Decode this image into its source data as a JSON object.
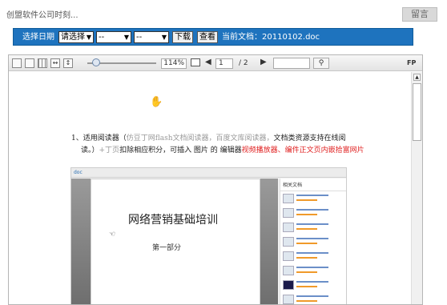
{
  "header": {
    "site_title": "创盟软件公司时刻...",
    "message_button": "留言"
  },
  "filter_bar": {
    "date_label": "选择日期",
    "select_year": "请选择",
    "select_month": "--",
    "select_day": "--",
    "download_button": "下载",
    "view_button": "查看",
    "current_doc_label": "当前文档：20110102.doc"
  },
  "viewer_toolbar": {
    "zoom": "114%",
    "page_current": "1",
    "page_total": "/ 2",
    "fp_label": "FP"
  },
  "document": {
    "item_number": "1、",
    "text_line1_a": "适用阅读器（",
    "text_line1_gray": "仿豆丁网flash文档阅读器，百度文库阅读器，",
    "text_line1_b": "文档类资源支持在线阅",
    "text_line2_a": "读。）",
    "text_line2_gray": "+丁页",
    "text_line2_b": "扣除相应积分，可插入 图片 的 编辑器",
    "text_line2_red": "视频播放器、编件正文页内嵌拾富网片",
    "embedded_title": "网络营销基础培训",
    "embedded_subtitle": "第一部分",
    "embedded_side_header": "相关文档",
    "embedded_toolbar_logo": "doc"
  },
  "colors": {
    "accent_blue": "#1e73be",
    "red_text": "#e02020"
  }
}
